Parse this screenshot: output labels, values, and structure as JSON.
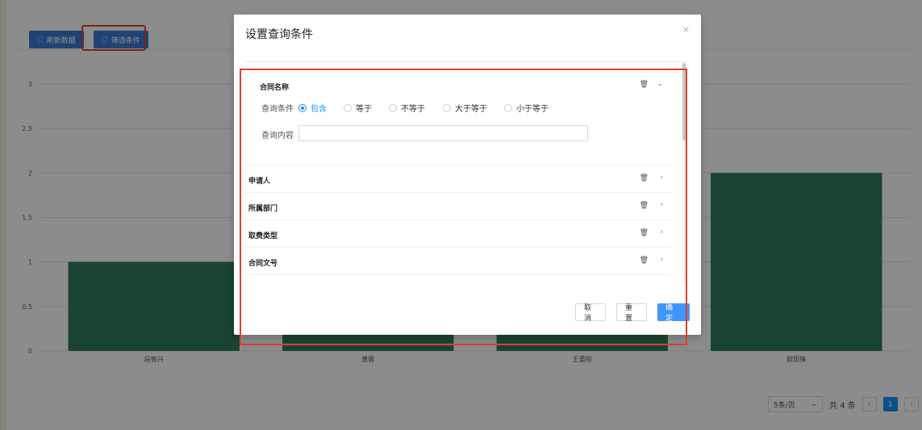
{
  "toolbar": {
    "refresh_label": "刷新数据",
    "filter_label": "筛选条件"
  },
  "chart_data": {
    "type": "bar",
    "categories": [
      "段智兴",
      "黄蓉",
      "王重阳",
      "欧阳锋"
    ],
    "values": [
      1,
      2,
      2,
      2
    ],
    "ylim": [
      0,
      3
    ],
    "yticks": [
      "0",
      "0.5",
      "1",
      "1.5",
      "2",
      "2.5",
      "3"
    ],
    "color": "#2e7d5b",
    "grid": true
  },
  "pagination": {
    "page_size": "5条/页",
    "total": "共 4 条",
    "current_page": "1"
  },
  "modal": {
    "title": "设置查询条件",
    "close_icon": "×",
    "condition_label": "查询条件",
    "content_label": "查询内容",
    "content_value": "",
    "options": [
      "包含",
      "等于",
      "不等于",
      "大于等于",
      "小于等于"
    ],
    "selected_option": "包含",
    "fields": [
      {
        "label": "合同名称",
        "expanded": true
      },
      {
        "label": "申请人",
        "expanded": false
      },
      {
        "label": "所属部门",
        "expanded": false
      },
      {
        "label": "取费类型",
        "expanded": false
      },
      {
        "label": "合同文号",
        "expanded": false
      }
    ],
    "cancel_label": "取 消",
    "reset_label": "重 置",
    "ok_label": "确 定"
  },
  "colors": {
    "highlight": "#e0402b",
    "primary": "#1890ff",
    "bar": "#2e7d5b"
  }
}
